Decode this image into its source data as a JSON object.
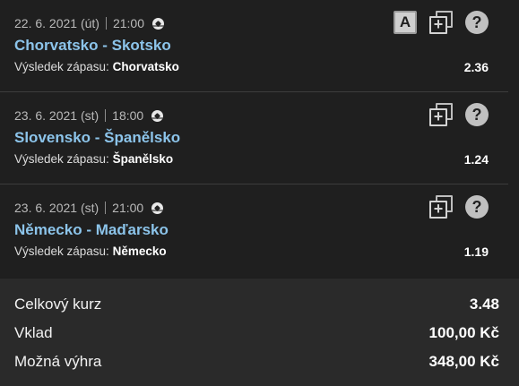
{
  "bets": [
    {
      "date": "22. 6. 2021 (út)",
      "time": "21:00",
      "match": "Chorvatsko - Skotsko",
      "market_label": "Výsledek zápasu:",
      "selection": "Chorvatsko",
      "odds": "2.36",
      "icons": [
        "a-icon",
        "add-copy-icon",
        "help-icon"
      ],
      "a_label": "A",
      "help_label": "?"
    },
    {
      "date": "23. 6. 2021 (st)",
      "time": "18:00",
      "match": "Slovensko - Španělsko",
      "market_label": "Výsledek zápasu:",
      "selection": "Španělsko",
      "odds": "1.24",
      "icons": [
        "add-copy-icon",
        "help-icon"
      ],
      "help_label": "?"
    },
    {
      "date": "23. 6. 2021 (st)",
      "time": "21:00",
      "match": "Německo - Maďarsko",
      "market_label": "Výsledek zápasu:",
      "selection": "Německo",
      "odds": "1.19",
      "icons": [
        "add-copy-icon",
        "help-icon"
      ],
      "help_label": "?"
    }
  ],
  "summary": {
    "total_odds_label": "Celkový kurz",
    "total_odds_value": "3.48",
    "stake_label": "Vklad",
    "stake_value": "100,00 Kč",
    "win_label": "Možná výhra",
    "win_value": "348,00 Kč"
  },
  "colors": {
    "match_link": "#8cc4ea",
    "background": "#1f1f1f",
    "summary_background": "#2a2a2a"
  }
}
